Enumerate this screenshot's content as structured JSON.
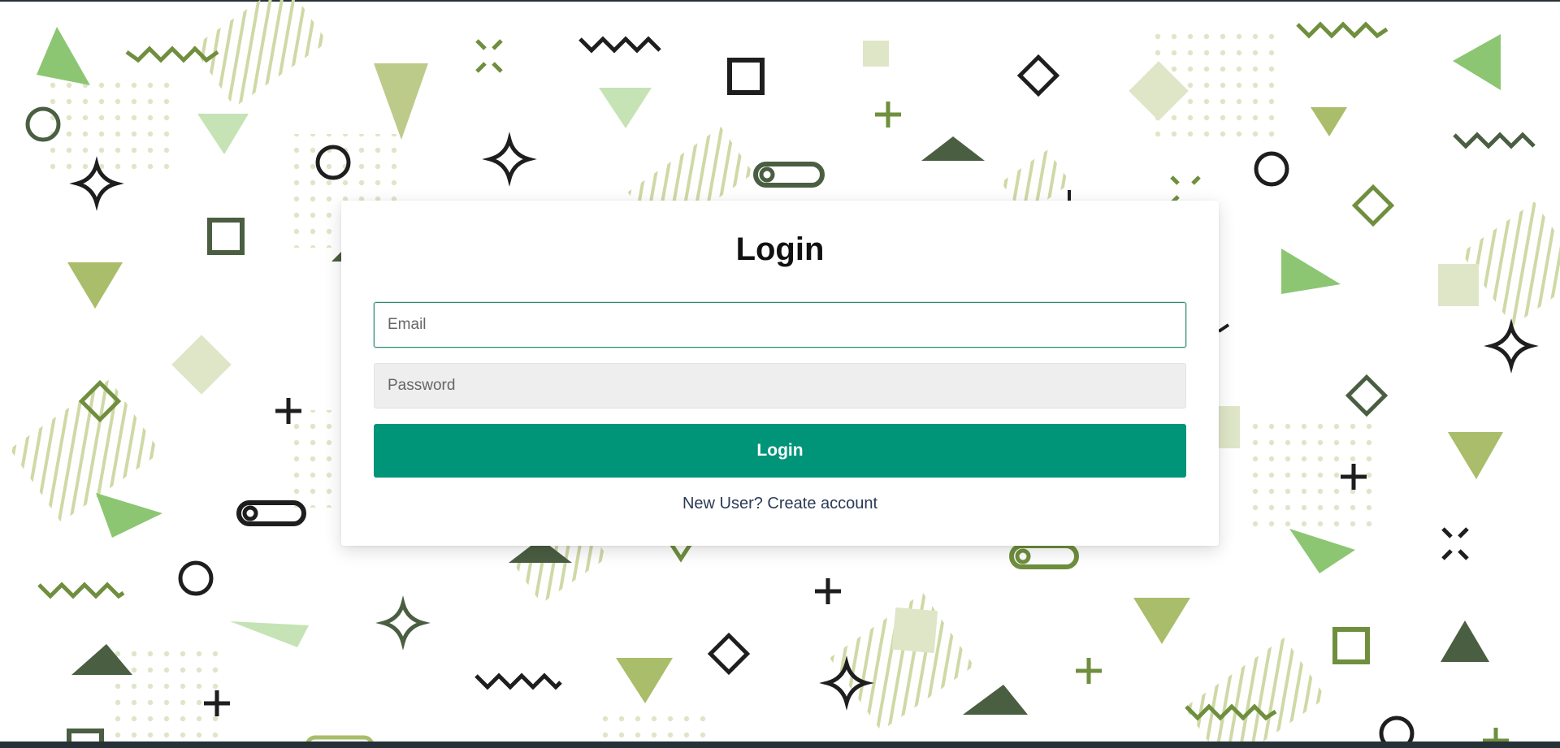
{
  "login": {
    "title": "Login",
    "email_placeholder": "Email",
    "password_placeholder": "Password",
    "submit_label": "Login",
    "signup_link_text": "New User? Create account"
  },
  "colors": {
    "accent": "#009479",
    "background_shapes_light": "#dfe6c8",
    "background_shapes_mid": "#a9bd6a",
    "background_shapes_dark": "#4a5e42"
  }
}
